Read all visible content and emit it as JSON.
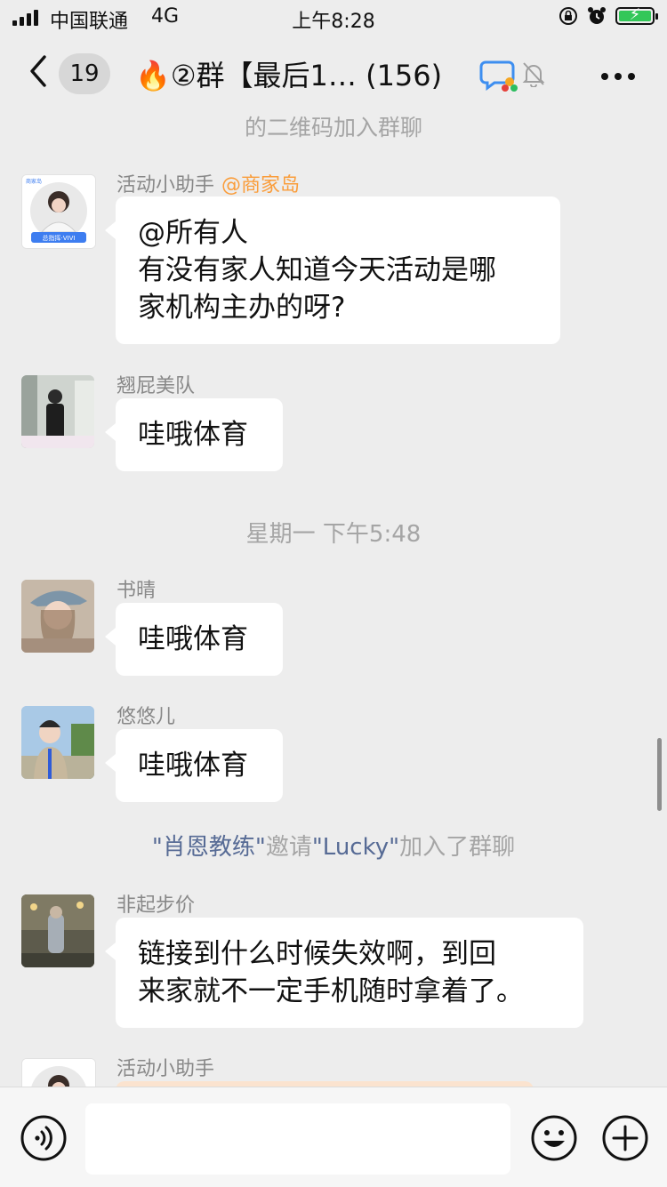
{
  "status_bar": {
    "carrier": "中国联通",
    "network": "4G",
    "time": "上午8:28"
  },
  "header": {
    "unread_count": "19",
    "title": "🔥②群【最后1…",
    "member_count": "(156)"
  },
  "chat": {
    "partial_system_line": "的二维码加入群聊",
    "messages": [
      {
        "sender": "活动小助手",
        "sender_tag": "@商家岛",
        "lines": [
          "@所有人",
          "有没有家人知道今天活动是哪",
          "家机构主办的呀?"
        ],
        "avatar_caption": "总指挥·VIVI",
        "avatar_logo": "商家岛"
      },
      {
        "sender": "翘屁美队",
        "lines": [
          "哇哦体育"
        ]
      },
      {
        "sender": "书晴",
        "lines": [
          "哇哦体育"
        ]
      },
      {
        "sender": "悠悠儿",
        "lines": [
          "哇哦体育"
        ]
      },
      {
        "sender": "非起步价",
        "lines": [
          "链接到什么时候失效啊，到回",
          "来家就不一定手机随时拿着了。"
        ]
      },
      {
        "sender": "活动小助手",
        "lines": []
      }
    ],
    "timestamp_divider": "星期一 下午5:48",
    "invite_notice": {
      "inviter": "\"肖恩教练\"",
      "verb": "邀请",
      "invitee": "\"Lucky\"",
      "suffix": "加入了群聊"
    }
  },
  "colors": {
    "background": "#ededed",
    "bubble": "#ffffff",
    "link": "#576b95",
    "tag": "#fa9d3b",
    "battery": "#33c759"
  },
  "icons": [
    "signal-icon",
    "alarm-lock-icon",
    "alarm-icon",
    "battery-icon",
    "back-icon",
    "group-chat-icon",
    "mute-icon",
    "more-icon",
    "voice-icon",
    "emoji-icon",
    "plus-icon"
  ]
}
